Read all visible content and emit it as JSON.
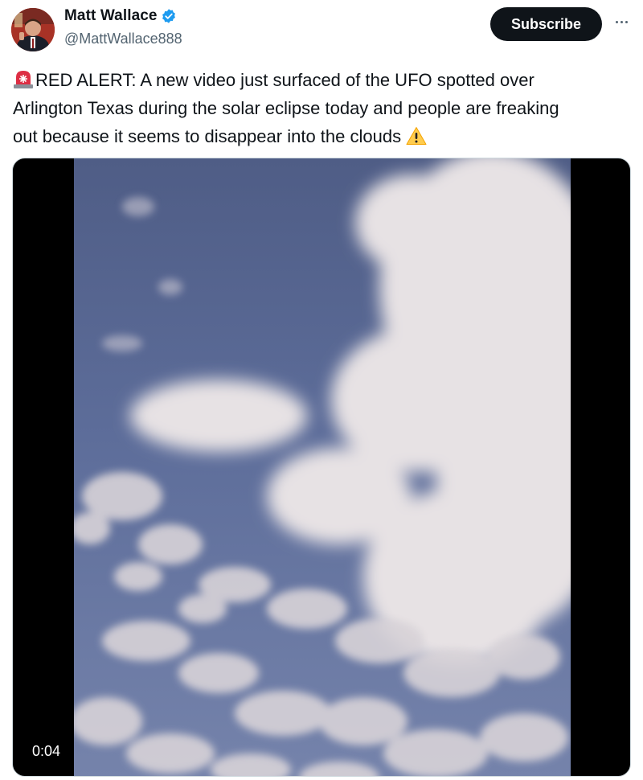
{
  "author": {
    "display_name": "Matt Wallace",
    "handle": "@MattWallace888",
    "verified": true,
    "avatar_icon": "profile-photo"
  },
  "actions": {
    "subscribe_label": "Subscribe",
    "more_icon": "more-options-icon"
  },
  "tweet": {
    "lead_icon": "police-light-emoji",
    "text_line1": "RED ALERT: A new video just surfaced of the UFO spotted over",
    "text_line2": "Arlington Texas during the solar eclipse today and people are freaking",
    "text_line3": "out because it seems to disappear into the clouds",
    "trail_icon": "warning-emoji"
  },
  "video": {
    "duration": "0:04",
    "content": "sky-with-clouds"
  },
  "colors": {
    "primary_text": "#0f1419",
    "secondary_text": "#536471",
    "verified_blue": "#1d9bf0",
    "button_bg": "#0f1419"
  }
}
